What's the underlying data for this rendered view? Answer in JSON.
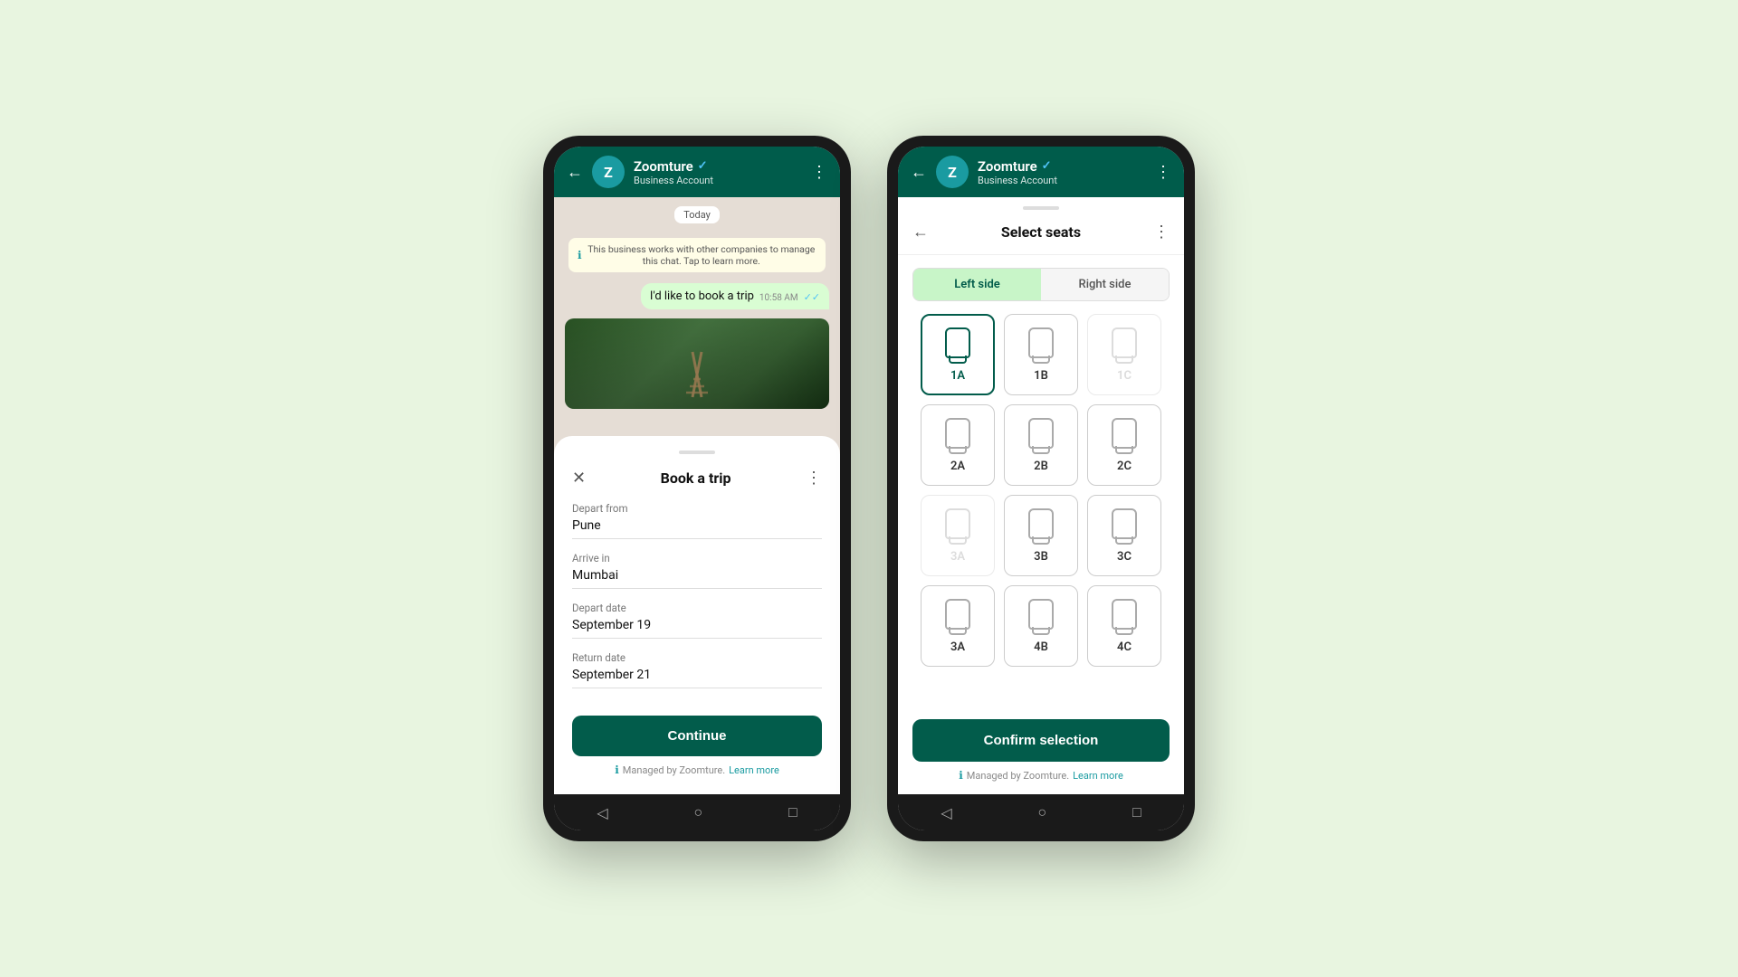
{
  "app": {
    "name": "Zoomture",
    "verified": "✓",
    "account_type": "Business Account",
    "avatar_letter": "Z"
  },
  "phone1": {
    "header": {
      "back_icon": "←",
      "more_icon": "⋮"
    },
    "chat": {
      "date_badge": "Today",
      "system_message": "This business works with other companies to manage this chat. Tap to learn more.",
      "sent_message": "I'd like to book a trip",
      "message_time": "10:58 AM",
      "message_ticks": "✓✓"
    },
    "sheet": {
      "title": "Book a trip",
      "close_icon": "✕",
      "more_icon": "⋮",
      "fields": [
        {
          "label": "Depart from",
          "value": "Pune"
        },
        {
          "label": "Arrive in",
          "value": "Mumbai"
        },
        {
          "label": "Depart date",
          "value": "September 19"
        },
        {
          "label": "Return date",
          "value": "September 21"
        }
      ],
      "continue_btn": "Continue",
      "footer_text": "Managed by Zoomture.",
      "footer_link": "Learn more"
    }
  },
  "phone2": {
    "header": {
      "back_icon": "←",
      "title": "Select seats",
      "more_icon": "⋮"
    },
    "tabs": [
      {
        "id": "left",
        "label": "Left side",
        "active": true
      },
      {
        "id": "right",
        "label": "Right side",
        "active": false
      }
    ],
    "seats": [
      [
        {
          "id": "1A",
          "label": "1A",
          "state": "selected"
        },
        {
          "id": "1B",
          "label": "1B",
          "state": "normal"
        },
        {
          "id": "1C",
          "label": "1C",
          "state": "unavailable"
        }
      ],
      [
        {
          "id": "2A",
          "label": "2A",
          "state": "normal"
        },
        {
          "id": "2B",
          "label": "2B",
          "state": "normal"
        },
        {
          "id": "2C",
          "label": "2C",
          "state": "normal"
        }
      ],
      [
        {
          "id": "3A-1",
          "label": "3A",
          "state": "unavailable"
        },
        {
          "id": "3B",
          "label": "3B",
          "state": "normal"
        },
        {
          "id": "3C",
          "label": "3C",
          "state": "normal"
        }
      ],
      [
        {
          "id": "3A-2",
          "label": "3A",
          "state": "normal"
        },
        {
          "id": "4B",
          "label": "4B",
          "state": "normal"
        },
        {
          "id": "4C",
          "label": "4C",
          "state": "normal"
        }
      ]
    ],
    "confirm_btn": "Confirm selection",
    "footer_text": "Managed by Zoomture.",
    "footer_link": "Learn more"
  }
}
